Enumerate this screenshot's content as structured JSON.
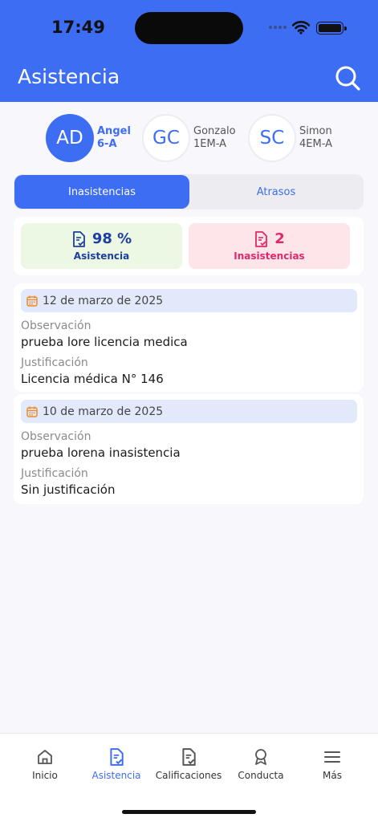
{
  "status_bar": {
    "time": "17:49"
  },
  "header": {
    "title": "Asistencia",
    "search_icon": "search-icon"
  },
  "students": [
    {
      "initials": "AD",
      "name": "Angel",
      "course": "6-A",
      "active": true
    },
    {
      "initials": "GC",
      "name": "Gonzalo",
      "course": "1EM-A",
      "active": false
    },
    {
      "initials": "SC",
      "name": "Simon",
      "course": "4EM-A",
      "active": false
    }
  ],
  "segments": {
    "active": "Inasistencias",
    "inactive": "Atrasos"
  },
  "summary": {
    "attendance": {
      "value": "98 %",
      "label": "Asistencia",
      "color": "#1c3fa0",
      "bg": "#edf8e4"
    },
    "absences": {
      "value": "2",
      "label": "Inasistencias",
      "color": "#e0286a",
      "bg": "#fde5ea"
    }
  },
  "records": [
    {
      "date": "12 de marzo de 2025",
      "observation_label": "Observación",
      "observation": "prueba lore licencia medica",
      "justification_label": "Justificación",
      "justification": "Licencia médica N° 146"
    },
    {
      "date": "10 de marzo de 2025",
      "observation_label": "Observación",
      "observation": "prueba lorena inasistencia",
      "justification_label": "Justificación",
      "justification": "Sin justificación"
    }
  ],
  "tabbar": {
    "items": [
      {
        "label": "Inicio",
        "icon": "home-icon"
      },
      {
        "label": "Asistencia",
        "icon": "document-check-icon"
      },
      {
        "label": "Calificaciones",
        "icon": "document-check-icon"
      },
      {
        "label": "Conducta",
        "icon": "award-icon"
      },
      {
        "label": "Más",
        "icon": "menu-icon"
      }
    ],
    "active": "Asistencia"
  },
  "colors": {
    "primary": "#3d6df2",
    "background": "#f8f8fc"
  }
}
